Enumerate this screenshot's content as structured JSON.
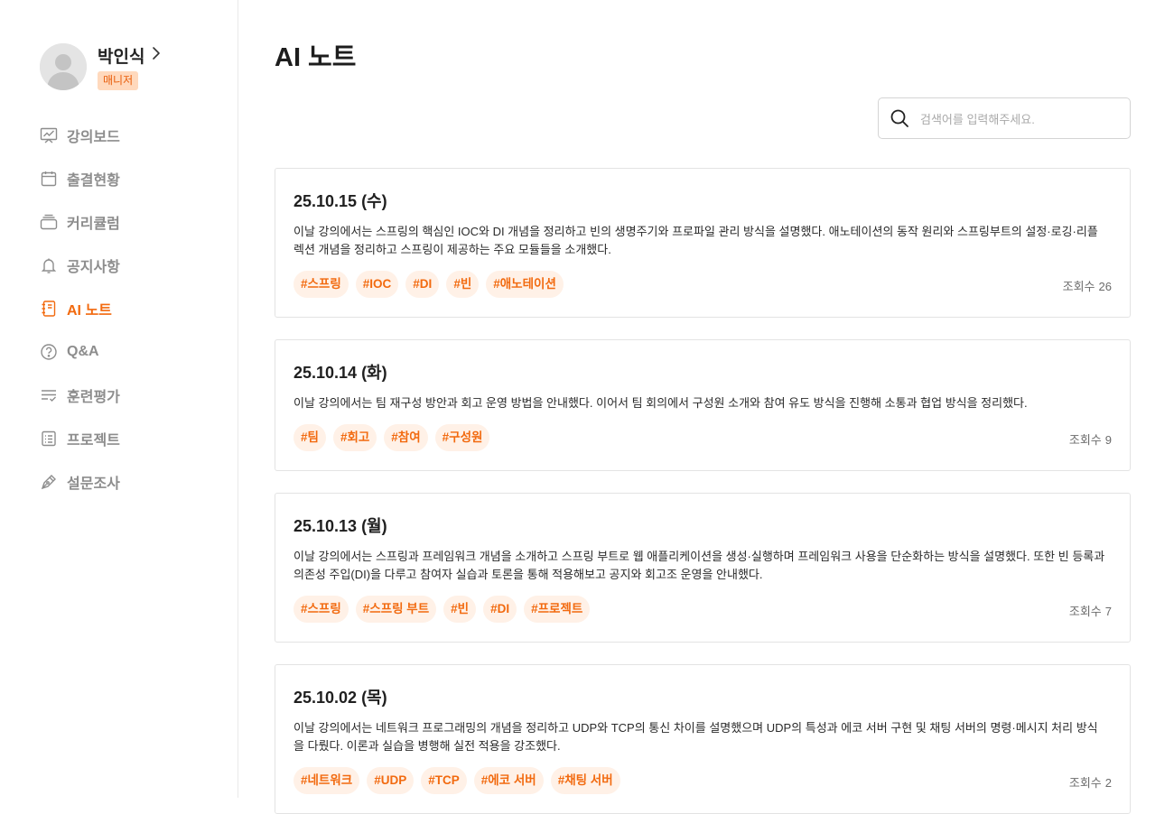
{
  "user": {
    "name": "박인식",
    "role": "매니저"
  },
  "nav": [
    {
      "label": "강의보드",
      "icon": "chart-board-icon"
    },
    {
      "label": "출결현황",
      "icon": "calendar-icon"
    },
    {
      "label": "커리큘럼",
      "icon": "stack-icon"
    },
    {
      "label": "공지사항",
      "icon": "bell-icon"
    },
    {
      "label": "AI 노트",
      "icon": "notebook-icon",
      "active": true
    },
    {
      "label": "Q&A",
      "icon": "question-icon"
    },
    {
      "label": "훈련평가",
      "icon": "checklist-icon"
    },
    {
      "label": "프로젝트",
      "icon": "list-doc-icon"
    },
    {
      "label": "설문조사",
      "icon": "pen-icon"
    }
  ],
  "page": {
    "title": "AI 노트"
  },
  "search": {
    "placeholder": "검색어를 입력해주세요."
  },
  "views_label": "조회수",
  "notes": [
    {
      "date": "25.10.15 (수)",
      "summary": "이날 강의에서는 스프링의 핵심인 IOC와 DI 개념을 정리하고 빈의 생명주기와 프로파일 관리 방식을 설명했다. 애노테이션의 동작 원리와 스프링부트의 설정·로깅·리플렉션 개념을 정리하고 스프링이 제공하는 주요 모듈들을 소개했다.",
      "tags": [
        "#스프링",
        "#IOC",
        "#DI",
        "#빈",
        "#애노테이션"
      ],
      "views": "26"
    },
    {
      "date": "25.10.14 (화)",
      "summary": "이날 강의에서는 팀 재구성 방안과 회고 운영 방법을 안내했다. 이어서 팀 회의에서 구성원 소개와 참여 유도 방식을 진행해 소통과 협업 방식을 정리했다.",
      "tags": [
        "#팀",
        "#회고",
        "#참여",
        "#구성원"
      ],
      "views": "9"
    },
    {
      "date": "25.10.13 (월)",
      "summary": "이날 강의에서는 스프링과 프레임워크 개념을 소개하고 스프링 부트로 웹 애플리케이션을 생성·실행하며 프레임워크 사용을 단순화하는 방식을 설명했다. 또한 빈 등록과 의존성 주입(DI)을 다루고 참여자 실습과 토론을 통해 적용해보고 공지와 회고조 운영을 안내했다.",
      "tags": [
        "#스프링",
        "#스프링 부트",
        "#빈",
        "#DI",
        "#프로젝트"
      ],
      "views": "7"
    },
    {
      "date": "25.10.02 (목)",
      "summary": "이날 강의에서는 네트워크 프로그래밍의 개념을 정리하고 UDP와 TCP의 통신 차이를 설명했으며 UDP의 특성과 에코 서버 구현 및 채팅 서버의 명령·메시지 처리 방식을 다뤘다. 이론과 실습을 병행해 실전 적용을 강조했다.",
      "tags": [
        "#네트워크",
        "#UDP",
        "#TCP",
        "#에코 서버",
        "#채팅 서버"
      ],
      "views": "2"
    }
  ]
}
